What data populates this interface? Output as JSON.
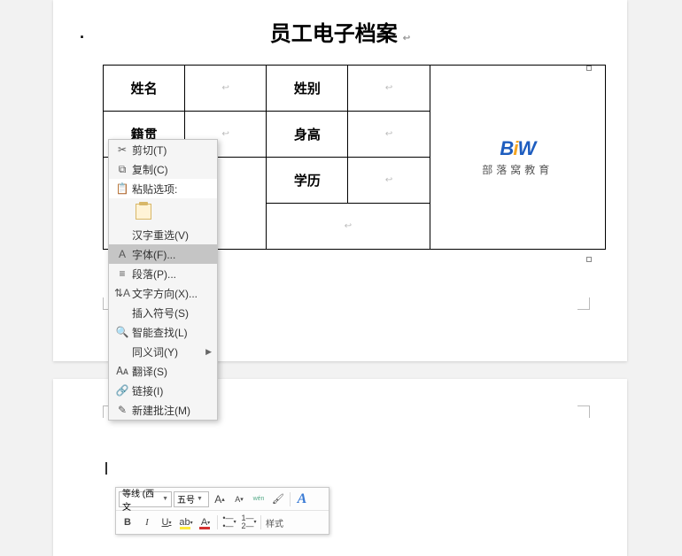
{
  "title": "员工电子档案",
  "table": {
    "r1c1": "姓名",
    "r1c3": "姓别",
    "r2c1": "籍贯",
    "r2c3": "身高",
    "r3c3": "学历"
  },
  "logo": {
    "brand_prefix": "B",
    "brand_mid": "i",
    "brand_suffix": "W",
    "sub": "部落窝教育"
  },
  "context_menu": {
    "cut": "剪切(T)",
    "copy": "复制(C)",
    "paste_label": "粘贴选项:",
    "hanzi": "汉字重选(V)",
    "font": "字体(F)...",
    "paragraph": "段落(P)...",
    "direction": "文字方向(X)...",
    "symbol": "插入符号(S)",
    "smart": "智能查找(L)",
    "synonym": "同义词(Y)",
    "translate": "翻译(S)",
    "link": "链接(I)",
    "comment": "新建批注(M)"
  },
  "mini_toolbar": {
    "font_name": "等线 (西文",
    "font_size": "五号",
    "grow": "A▴",
    "shrink": "A▾",
    "phonetic": "wén",
    "bold": "B",
    "italic": "I",
    "underline": "U",
    "style_label": "样式"
  }
}
